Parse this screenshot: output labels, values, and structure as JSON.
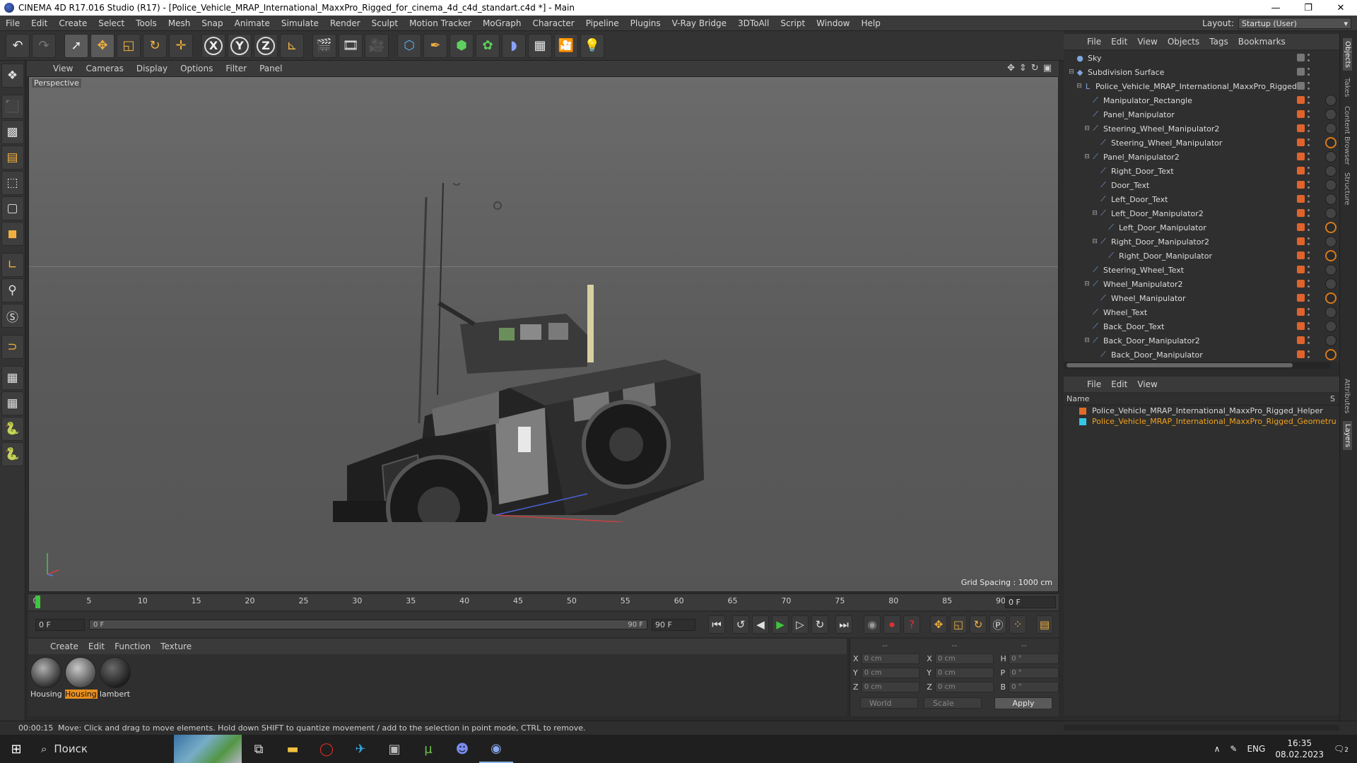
{
  "window": {
    "title": "CINEMA 4D R17.016 Studio (R17) - [Police_Vehicle_MRAP_International_MaxxPro_Rigged_for_cinema_4d_c4d_standart.c4d *] - Main",
    "minimize": "—",
    "maximize": "❐",
    "close": "✕"
  },
  "menubar": {
    "items": [
      "File",
      "Edit",
      "Create",
      "Select",
      "Tools",
      "Mesh",
      "Snap",
      "Animate",
      "Simulate",
      "Render",
      "Sculpt",
      "Motion Tracker",
      "MoGraph",
      "Character",
      "Pipeline",
      "Plugins",
      "V-Ray Bridge",
      "3DToAll",
      "Script",
      "Window",
      "Help"
    ],
    "layout_label": "Layout:",
    "layout_value": "Startup (User)"
  },
  "viewport": {
    "menu": [
      "View",
      "Cameras",
      "Display",
      "Options",
      "Filter",
      "Panel"
    ],
    "camera": "Perspective",
    "grid_spacing": "Grid Spacing : 1000 cm"
  },
  "timeline": {
    "ticks": [
      "0",
      "5",
      "10",
      "15",
      "20",
      "25",
      "30",
      "35",
      "40",
      "45",
      "50",
      "55",
      "60",
      "65",
      "70",
      "75",
      "80",
      "85",
      "90"
    ],
    "current_frame": "0 F",
    "start_field": "0 F",
    "slider_start": "0 F",
    "slider_end": "90 F",
    "end_field": "90 F"
  },
  "material_manager": {
    "menu": [
      "Create",
      "Edit",
      "Function",
      "Texture"
    ],
    "materials": [
      {
        "name": "Housing",
        "selected": false
      },
      {
        "name": "Housing",
        "selected": true
      },
      {
        "name": "lambert",
        "selected": false
      }
    ]
  },
  "coordinates": {
    "headers": [
      "--",
      "--",
      "--"
    ],
    "rows": [
      {
        "a": "X",
        "av": "0 cm",
        "b": "X",
        "bv": "0 cm",
        "c": "H",
        "cv": "0 °"
      },
      {
        "a": "Y",
        "av": "0 cm",
        "b": "Y",
        "bv": "0 cm",
        "c": "P",
        "cv": "0 °"
      },
      {
        "a": "Z",
        "av": "0 cm",
        "b": "Z",
        "bv": "0 cm",
        "c": "B",
        "cv": "0 °"
      }
    ],
    "world": "World",
    "scale": "Scale",
    "apply": "Apply"
  },
  "status": {
    "time": "00:00:15",
    "message": "Move: Click and drag to move elements. Hold down SHIFT to quantize movement / add to the selection in point mode, CTRL to remove."
  },
  "object_manager": {
    "menu": [
      "File",
      "Edit",
      "View",
      "Objects",
      "Tags",
      "Bookmarks"
    ],
    "objects": [
      {
        "name": "Sky",
        "depth": 0,
        "toggle": "",
        "icon": "●",
        "tag": ""
      },
      {
        "name": "Subdivision Surface",
        "depth": 0,
        "toggle": "⊟",
        "icon": "◆",
        "tag": ""
      },
      {
        "name": "Police_Vehicle_MRAP_International_MaxxPro_Rigged",
        "depth": 1,
        "toggle": "⊟",
        "icon": "L",
        "tag": ""
      },
      {
        "name": "Manipulator_Rectangle",
        "depth": 2,
        "toggle": "",
        "icon": "⟋",
        "tag": "o"
      },
      {
        "name": "Panel_Manipulator",
        "depth": 2,
        "toggle": "",
        "icon": "⟋",
        "tag": "o"
      },
      {
        "name": "Steering_Wheel_Manipulator2",
        "depth": 2,
        "toggle": "⊟",
        "icon": "⟋",
        "tag": "o"
      },
      {
        "name": "Steering_Wheel_Manipulator",
        "depth": 3,
        "toggle": "",
        "icon": "⟋",
        "tag": "no"
      },
      {
        "name": "Panel_Manipulator2",
        "depth": 2,
        "toggle": "⊟",
        "icon": "⟋",
        "tag": "o"
      },
      {
        "name": "Right_Door_Text",
        "depth": 3,
        "toggle": "",
        "icon": "⟋",
        "tag": "o"
      },
      {
        "name": "Door_Text",
        "depth": 3,
        "toggle": "",
        "icon": "⟋",
        "tag": "o"
      },
      {
        "name": "Left_Door_Text",
        "depth": 3,
        "toggle": "",
        "icon": "⟋",
        "tag": "o"
      },
      {
        "name": "Left_Door_Manipulator2",
        "depth": 3,
        "toggle": "⊟",
        "icon": "⟋",
        "tag": "o"
      },
      {
        "name": "Left_Door_Manipulator",
        "depth": 4,
        "toggle": "",
        "icon": "⟋",
        "tag": "no"
      },
      {
        "name": "Right_Door_Manipulator2",
        "depth": 3,
        "toggle": "⊟",
        "icon": "⟋",
        "tag": "o"
      },
      {
        "name": "Right_Door_Manipulator",
        "depth": 4,
        "toggle": "",
        "icon": "⟋",
        "tag": "no"
      },
      {
        "name": "Steering_Wheel_Text",
        "depth": 2,
        "toggle": "",
        "icon": "⟋",
        "tag": "o"
      },
      {
        "name": "Wheel_Manipulator2",
        "depth": 2,
        "toggle": "⊟",
        "icon": "⟋",
        "tag": "o"
      },
      {
        "name": "Wheel_Manipulator",
        "depth": 3,
        "toggle": "",
        "icon": "⟋",
        "tag": "no"
      },
      {
        "name": "Wheel_Text",
        "depth": 2,
        "toggle": "",
        "icon": "⟋",
        "tag": "o"
      },
      {
        "name": "Back_Door_Text",
        "depth": 2,
        "toggle": "",
        "icon": "⟋",
        "tag": "o"
      },
      {
        "name": "Back_Door_Manipulator2",
        "depth": 2,
        "toggle": "⊟",
        "icon": "⟋",
        "tag": "o"
      },
      {
        "name": "Back_Door_Manipulator",
        "depth": 3,
        "toggle": "",
        "icon": "⟋",
        "tag": "no"
      }
    ]
  },
  "layer_manager": {
    "menu": [
      "File",
      "Edit",
      "View"
    ],
    "col_name": "Name",
    "col_s": "S",
    "layers": [
      {
        "name": "Police_Vehicle_MRAP_International_MaxxPro_Rigged_Helper",
        "color": "#e06a2a",
        "text_color": "#d8d8d8"
      },
      {
        "name": "Police_Vehicle_MRAP_International_MaxxPro_Rigged_Geometru",
        "color": "#35c6e6",
        "text_color": "#f0a21e"
      }
    ]
  },
  "sidetabs": [
    "Objects",
    "Takes",
    "Content Browser",
    "Structure",
    "Attributes",
    "Layers"
  ],
  "taskbar": {
    "search": "Поиск",
    "lang": "ENG",
    "time": "16:35",
    "date": "08.02.2023",
    "notif": "2"
  },
  "colors": {
    "accent_orange": "#e88f1e",
    "playhead_green": "#3ec43e"
  }
}
